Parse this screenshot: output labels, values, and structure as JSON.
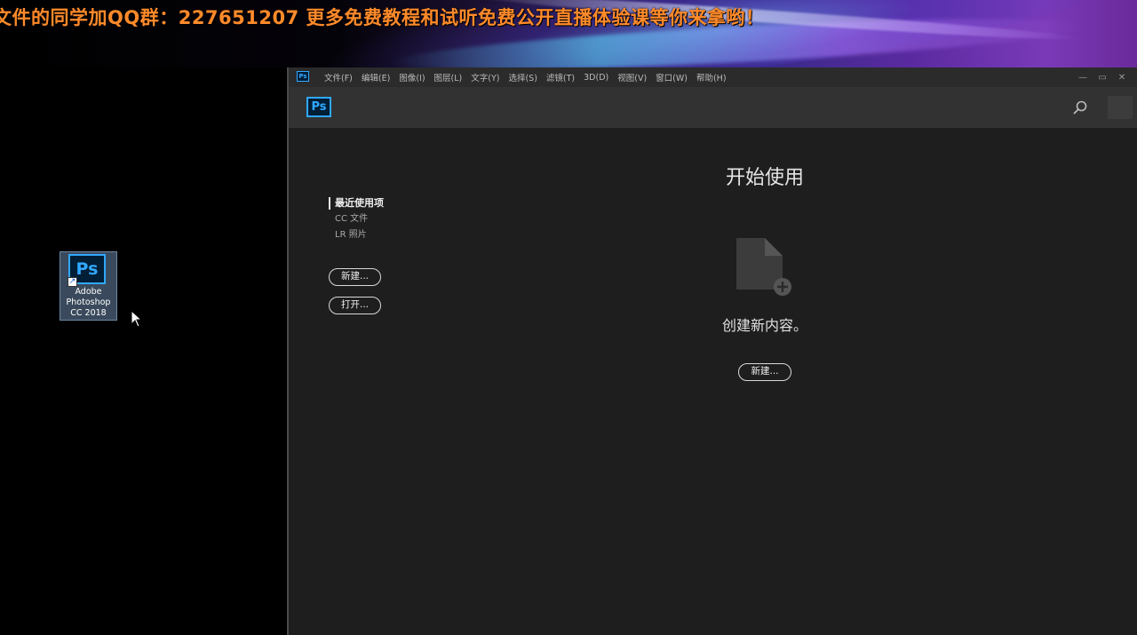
{
  "banner": {
    "text": "文件的同学加QQ群：227651207 更多免费教程和试听免费公开直播体验课等你来拿哟！"
  },
  "desktop": {
    "icon": {
      "ps_text": "Ps",
      "label_lines": [
        "Adobe",
        "Photoshop",
        "CC 2018"
      ]
    }
  },
  "window": {
    "app_icon_text": "Ps",
    "menu": [
      "文件(F)",
      "编辑(E)",
      "图像(I)",
      "图层(L)",
      "文字(Y)",
      "选择(S)",
      "滤镜(T)",
      "3D(D)",
      "视图(V)",
      "窗口(W)",
      "帮助(H)"
    ],
    "controls": {
      "minimize": "—",
      "maximize": "▭",
      "close": "✕"
    }
  },
  "header": {
    "logo_text": "Ps",
    "icons": [
      "search-icon"
    ]
  },
  "sidebar": {
    "items": [
      {
        "label": "最近使用项",
        "active": true
      },
      {
        "label": "CC 文件",
        "active": false
      },
      {
        "label": "LR 照片",
        "active": false
      }
    ],
    "buttons": {
      "new": "新建...",
      "open": "打开..."
    }
  },
  "main": {
    "title": "开始使用",
    "message": "创建新内容。",
    "new_button": "新建..."
  },
  "colors": {
    "banner_text": "#ff8a2a",
    "ps_blue": "#31a8ff",
    "ps_dark": "#001e36",
    "window_bg": "#1e1e1e",
    "header_bg": "#323232"
  }
}
